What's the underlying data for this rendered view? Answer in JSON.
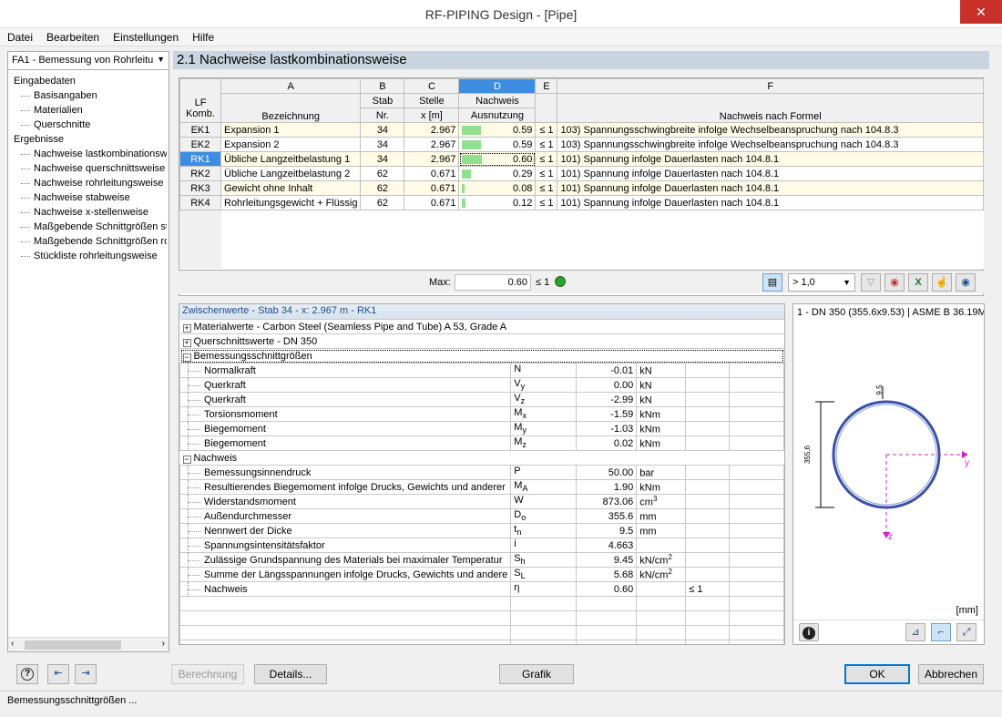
{
  "window": {
    "title": "RF-PIPING Design - [Pipe]"
  },
  "menu": [
    "Datei",
    "Bearbeiten",
    "Einstellungen",
    "Hilfe"
  ],
  "left": {
    "combo": "FA1 - Bemessung von Rohrleitu",
    "tree": [
      {
        "label": "Eingabedaten",
        "level": 1
      },
      {
        "label": "Basisangaben",
        "level": 2
      },
      {
        "label": "Materialien",
        "level": 2
      },
      {
        "label": "Querschnitte",
        "level": 2
      },
      {
        "label": "Ergebnisse",
        "level": 1
      },
      {
        "label": "Nachweise lastkombinationsweise",
        "level": 2
      },
      {
        "label": "Nachweise querschnittsweise",
        "level": 2
      },
      {
        "label": "Nachweise rohrleitungsweise",
        "level": 2
      },
      {
        "label": "Nachweise stabweise",
        "level": 2
      },
      {
        "label": "Nachweise x-stellenweise",
        "level": 2
      },
      {
        "label": "Maßgebende Schnittgrößen sta",
        "level": 2
      },
      {
        "label": "Maßgebende Schnittgrößen roh",
        "level": 2
      },
      {
        "label": "Stückliste rohrleitungsweise",
        "level": 2
      }
    ]
  },
  "section_title": "2.1 Nachweise lastkombinationsweise",
  "grid": {
    "col_letters": [
      "A",
      "B",
      "C",
      "D",
      "E",
      "F"
    ],
    "hdr_lf": "LF",
    "hdr_komb": "Komb.",
    "hdr_bez": "Bezeichnung",
    "hdr_stab1": "Stab",
    "hdr_stab2": "Nr.",
    "hdr_stelle1": "Stelle",
    "hdr_stelle2": "x [m]",
    "hdr_nachweis1": "Nachweis",
    "hdr_nachweis2": "Ausnutzung",
    "hdr_formel": "Nachweis nach Formel",
    "rows": [
      {
        "id": "EK1",
        "bez": "Expansion 1",
        "stab": "34",
        "x": "2.967",
        "aus": "0.59",
        "ratio": 0.59,
        "le": "≤ 1",
        "formel": "103) Spannungsschwingbreite infolge Wechselbeanspruchung nach 104.8.3"
      },
      {
        "id": "EK2",
        "bez": "Expansion 2",
        "stab": "34",
        "x": "2.967",
        "aus": "0.59",
        "ratio": 0.59,
        "le": "≤ 1",
        "formel": "103) Spannungsschwingbreite infolge Wechselbeanspruchung nach 104.8.3"
      },
      {
        "id": "RK1",
        "bez": "Übliche Langzeitbelastung 1",
        "stab": "34",
        "x": "2.967",
        "aus": "0.60",
        "ratio": 0.6,
        "le": "≤ 1",
        "formel": "101) Spannung infolge Dauerlasten nach 104.8.1"
      },
      {
        "id": "RK2",
        "bez": "Übliche Langzeitbelastung 2",
        "stab": "62",
        "x": "0.671",
        "aus": "0.29",
        "ratio": 0.29,
        "le": "≤ 1",
        "formel": "101) Spannung infolge Dauerlasten nach 104.8.1"
      },
      {
        "id": "RK3",
        "bez": "Gewicht ohne Inhalt",
        "stab": "62",
        "x": "0.671",
        "aus": "0.08",
        "ratio": 0.08,
        "le": "≤ 1",
        "formel": "101) Spannung infolge Dauerlasten nach 104.8.1"
      },
      {
        "id": "RK4",
        "bez": "Rohrleitungsgewicht + Flüssig",
        "stab": "62",
        "x": "0.671",
        "aus": "0.12",
        "ratio": 0.12,
        "le": "≤ 1",
        "formel": "101) Spannung infolge Dauerlasten nach 104.8.1"
      }
    ],
    "max_label": "Max:",
    "max_value": "0.60",
    "max_le": "≤ 1",
    "filter_value": "> 1,0"
  },
  "sub": {
    "title": "Zwischenwerte  -  Stab 34  -  x: 2.967 m  -  RK1",
    "material": "Materialwerte  -  Carbon Steel (Seamless Pipe and Tube) A 53, Grade A",
    "querschnitt": "Querschnittswerte  -  DN 350",
    "bemessung": "Bemessungsschnittgrößen",
    "forces": [
      {
        "name": "Normalkraft",
        "sym": "N",
        "sub": "",
        "val": "-0.01",
        "unit": "kN",
        "sup": ""
      },
      {
        "name": "Querkraft",
        "sym": "V",
        "sub": "y",
        "val": "0.00",
        "unit": "kN",
        "sup": ""
      },
      {
        "name": "Querkraft",
        "sym": "V",
        "sub": "z",
        "val": "-2.99",
        "unit": "kN",
        "sup": ""
      },
      {
        "name": "Torsionsmoment",
        "sym": "M",
        "sub": "x",
        "val": "-1.59",
        "unit": "kNm",
        "sup": ""
      },
      {
        "name": "Biegemoment",
        "sym": "M",
        "sub": "y",
        "val": "-1.03",
        "unit": "kNm",
        "sup": ""
      },
      {
        "name": "Biegemoment",
        "sym": "M",
        "sub": "z",
        "val": "0.02",
        "unit": "kNm",
        "sup": ""
      }
    ],
    "nachweis": "Nachweis",
    "checks": [
      {
        "name": "Bemessungsinnendruck",
        "sym": "P",
        "sub": "",
        "val": "50.00",
        "unit": "bar",
        "sup": ""
      },
      {
        "name": "Resultierendes Biegemoment infolge Drucks, Gewichts und anderer",
        "sym": "M",
        "sub": "A",
        "val": "1.90",
        "unit": "kNm",
        "sup": ""
      },
      {
        "name": "Widerstandsmoment",
        "sym": "W",
        "sub": "",
        "val": "873.06",
        "unit": "cm",
        "sup": "3"
      },
      {
        "name": "Außendurchmesser",
        "sym": "D",
        "sub": "o",
        "val": "355.6",
        "unit": "mm",
        "sup": ""
      },
      {
        "name": "Nennwert der Dicke",
        "sym": "t",
        "sub": "n",
        "val": "9.5",
        "unit": "mm",
        "sup": ""
      },
      {
        "name": "Spannungsintensitätsfaktor",
        "sym": "i",
        "sub": "",
        "val": "4.663",
        "unit": "",
        "sup": ""
      },
      {
        "name": "Zulässige Grundspannung des Materials bei maximaler Temperatur",
        "sym": "S",
        "sub": "h",
        "val": "9.45",
        "unit": "kN/cm",
        "sup": "2"
      },
      {
        "name": "Summe der Längsspannungen infolge Drucks, Gewichts und andere",
        "sym": "S",
        "sub": "L",
        "val": "5.68",
        "unit": "kN/cm",
        "sup": "2"
      },
      {
        "name": "Nachweis",
        "sym": "η",
        "sub": "",
        "val": "0.60",
        "unit": "",
        "sup": "",
        "le": "≤ 1"
      }
    ]
  },
  "graph": {
    "title": "1 - DN 350 (355.6x9.53) | ASME B 36.19M",
    "dim_t": "9.5",
    "dim_d": "355.6",
    "axis_y": "y",
    "axis_z": "z",
    "unit": "[mm]"
  },
  "buttons": {
    "berechnung": "Berechnung",
    "details": "Details...",
    "grafik": "Grafik",
    "ok": "OK",
    "abbrechen": "Abbrechen"
  },
  "status": "Bemessungsschnittgrößen ..."
}
